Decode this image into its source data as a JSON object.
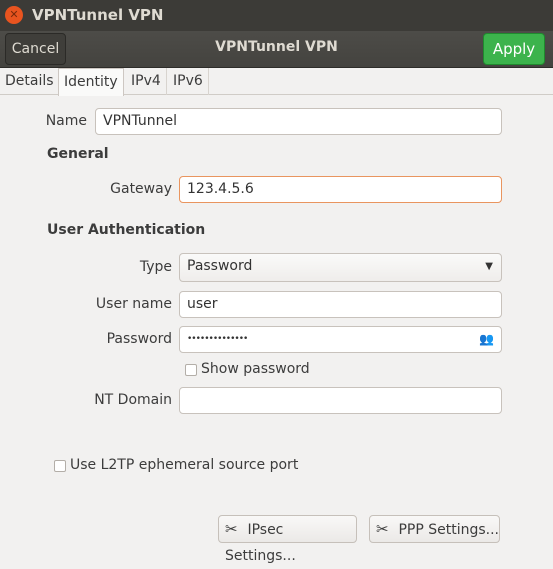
{
  "window": {
    "title": "VPNTunnel VPN"
  },
  "header": {
    "cancel": "Cancel",
    "title": "VPNTunnel VPN",
    "apply": "Apply",
    "apply_color": "#3cb34c"
  },
  "tabs": [
    {
      "label": "Details"
    },
    {
      "label": "Identity",
      "active": true
    },
    {
      "label": "IPv4"
    },
    {
      "label": "IPv6"
    }
  ],
  "form": {
    "name_label": "Name",
    "name_value": "VPNTunnel",
    "general_heading": "General",
    "gateway_label": "Gateway",
    "gateway_value": "123.4.5.6",
    "auth_heading": "User Authentication",
    "type_label": "Type",
    "type_value": "Password",
    "username_label": "User name",
    "username_value": "user",
    "password_label": "Password",
    "password_value": "••••••••••••••",
    "show_password": "Show password",
    "ntdomain_label": "NT Domain",
    "ntdomain_value": "",
    "l2tp_label": "Use L2TP ephemeral source port"
  },
  "buttons": {
    "ipsec": "IPsec Settings...",
    "ppp": "PPP Settings..."
  }
}
